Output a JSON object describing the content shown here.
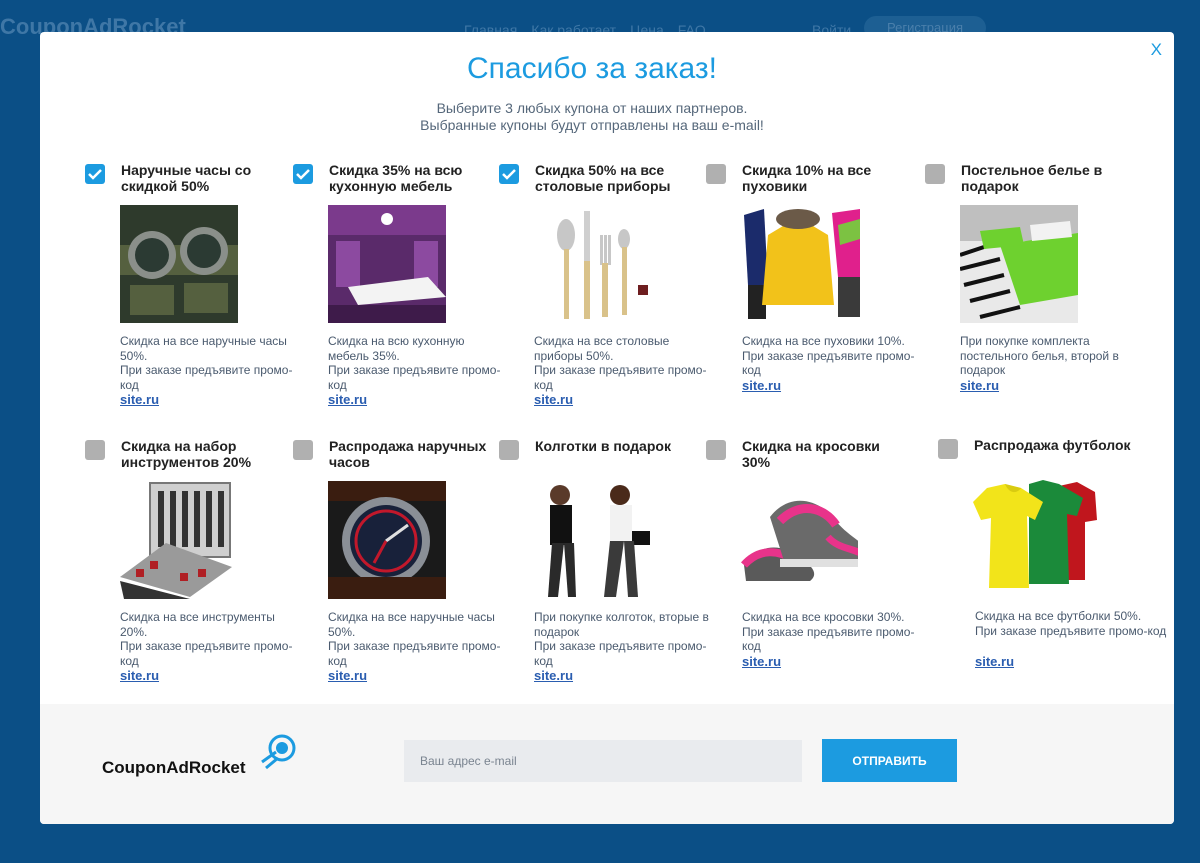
{
  "background": {
    "logo": "CouponAdRocket",
    "nav": [
      "Главная",
      "Как работает",
      "Цена",
      "FAQ"
    ],
    "login": "Войти",
    "register": "Регистрация"
  },
  "modal": {
    "close": "X",
    "title": "Спасибо за заказ!",
    "subtitle_line1": "Выберите 3 любых купона от наших партнеров.",
    "subtitle_line2": "Выбранные купоны будут отправлены на ваш e-mail!"
  },
  "coupons": [
    {
      "title": "Наручные часы со скидкой 50%",
      "checked": true,
      "image": "watch-photo",
      "desc": [
        "Скидка на все наручные часы 50%.",
        "При заказе предъявите промо-код"
      ],
      "link": "site.ru"
    },
    {
      "title": "Скидка 35% на всю кухонную мебель",
      "checked": true,
      "image": "kitchen-photo",
      "desc": [
        "Скидка на всю кухонную мебель 35%.",
        "При заказе предъявите промо-код"
      ],
      "link": "site.ru"
    },
    {
      "title": "Скидка 50% на все столовые приборы",
      "checked": true,
      "image": "cutlery-photo",
      "desc": [
        "Скидка на все столовые приборы 50%.",
        "При заказе предъявите промо-код"
      ],
      "link": "site.ru"
    },
    {
      "title": "Скидка 10% на все пуховики",
      "checked": false,
      "image": "jackets-photo",
      "desc": [
        "Скидка на все пуховики 10%.",
        "При заказе предъявите промо-код"
      ],
      "link": "site.ru"
    },
    {
      "title": "Постельное белье в подарок",
      "checked": false,
      "image": "bedding-photo",
      "desc": [
        "При покупке комплекта постельного белья, второй в подарок"
      ],
      "link": "site.ru"
    },
    {
      "title": "Скидка на набор инструментов 20%",
      "checked": false,
      "image": "tools-photo",
      "desc": [
        "Скидка на все инструменты 20%.",
        "При заказе предъявите промо-код"
      ],
      "link": "site.ru"
    },
    {
      "title": "Распродажа наручных часов",
      "checked": false,
      "image": "wristwatch-photo",
      "desc": [
        "Скидка на все наручные часы 50%.",
        "При заказе предъявите промо-код"
      ],
      "link": "site.ru"
    },
    {
      "title": "Колготки в подарок",
      "checked": false,
      "image": "tights-photo",
      "desc": [
        "При покупке колготок, вторые в подарок",
        "При заказе предъявите промо-код"
      ],
      "link": "site.ru"
    },
    {
      "title": "Скидка на кросовки 30%",
      "checked": false,
      "image": "sneakers-photo",
      "desc": [
        "Скидка на все кросовки 30%.",
        "При заказе предъявите промо-код"
      ],
      "link": "site.ru"
    },
    {
      "title": "Распродажа футболок",
      "checked": false,
      "image": "tshirts-photo",
      "desc": [
        "Скидка на все футболки 50%.",
        "При заказе предъявите промо-код"
      ],
      "link": "site.ru"
    }
  ],
  "footer": {
    "logo": "CouponAdRocket",
    "email_placeholder": "Ваш адрес e-mail",
    "send_label": "ОТПРАВИТЬ"
  },
  "colors": {
    "accent": "#1c9be0",
    "link": "#2a5db0",
    "page_bg": "#0b4f86",
    "unchecked": "#b0b0b0"
  }
}
